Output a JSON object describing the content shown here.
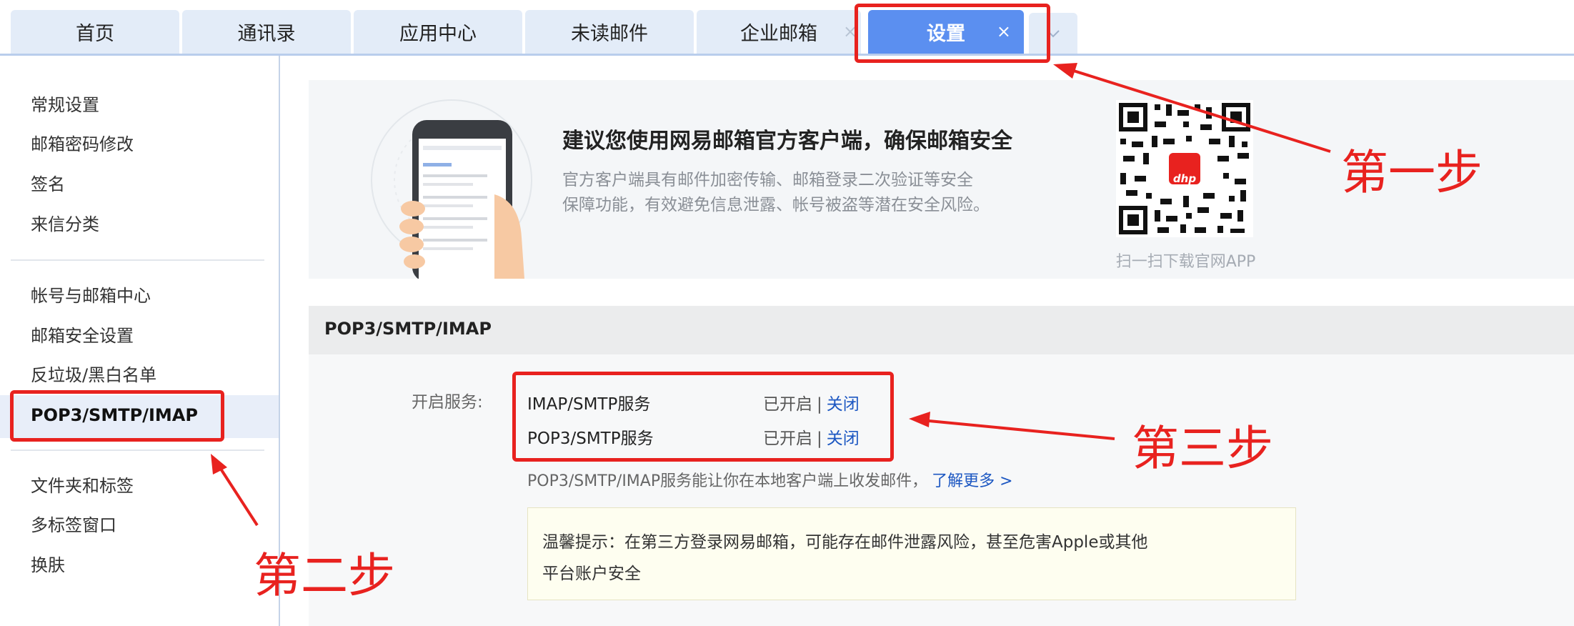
{
  "tabs": [
    {
      "label": "首页"
    },
    {
      "label": "通讯录"
    },
    {
      "label": "应用中心"
    },
    {
      "label": "未读邮件"
    },
    {
      "label": "企业邮箱"
    },
    {
      "label": "设置",
      "close": "×"
    }
  ],
  "sidebar": {
    "group1": [
      "常规设置",
      "邮箱密码修改",
      "签名",
      "来信分类"
    ],
    "group2": [
      "帐号与邮箱中心",
      "邮箱安全设置",
      "反垃圾/黑白名单",
      "POP3/SMTP/IMAP"
    ],
    "group3": [
      "文件夹和标签",
      "多标签窗口",
      "换肤"
    ]
  },
  "promo": {
    "title": "建议您使用网易邮箱官方客户端，确保邮箱安全",
    "desc_line1": "官方客户端具有邮件加密传输、邮箱登录二次验证等安全",
    "desc_line2": "保障功能，有效避免信息泄露、帐号被盗等潜在安全风险。",
    "qr_badge": "dhp",
    "qr_caption": "扫一扫下载官网APP"
  },
  "section": {
    "title": "POP3/SMTP/IMAP",
    "open_label": "开启服务:",
    "services": [
      {
        "name": "IMAP/SMTP服务",
        "status": "已开启",
        "sep": "|",
        "action": "关闭"
      },
      {
        "name": "POP3/SMTP服务",
        "status": "已开启",
        "sep": "|",
        "action": "关闭"
      }
    ],
    "desc": "POP3/SMTP/IMAP服务能让你在本地客户端上收发邮件，",
    "learn_more": "了解更多 >",
    "tip_line1": "温馨提示：在第三方登录网易邮箱，可能存在邮件泄露风险，甚至危害Apple或其他",
    "tip_line2": "平台账户安全"
  },
  "annotations": {
    "step1": "第一步",
    "step2": "第二步",
    "step3": "第三步",
    "color": "#e8221f"
  },
  "colors": {
    "active_tab": "#5b8ff0",
    "tab_bg": "#e3ecf8",
    "link": "#1c57c2"
  }
}
